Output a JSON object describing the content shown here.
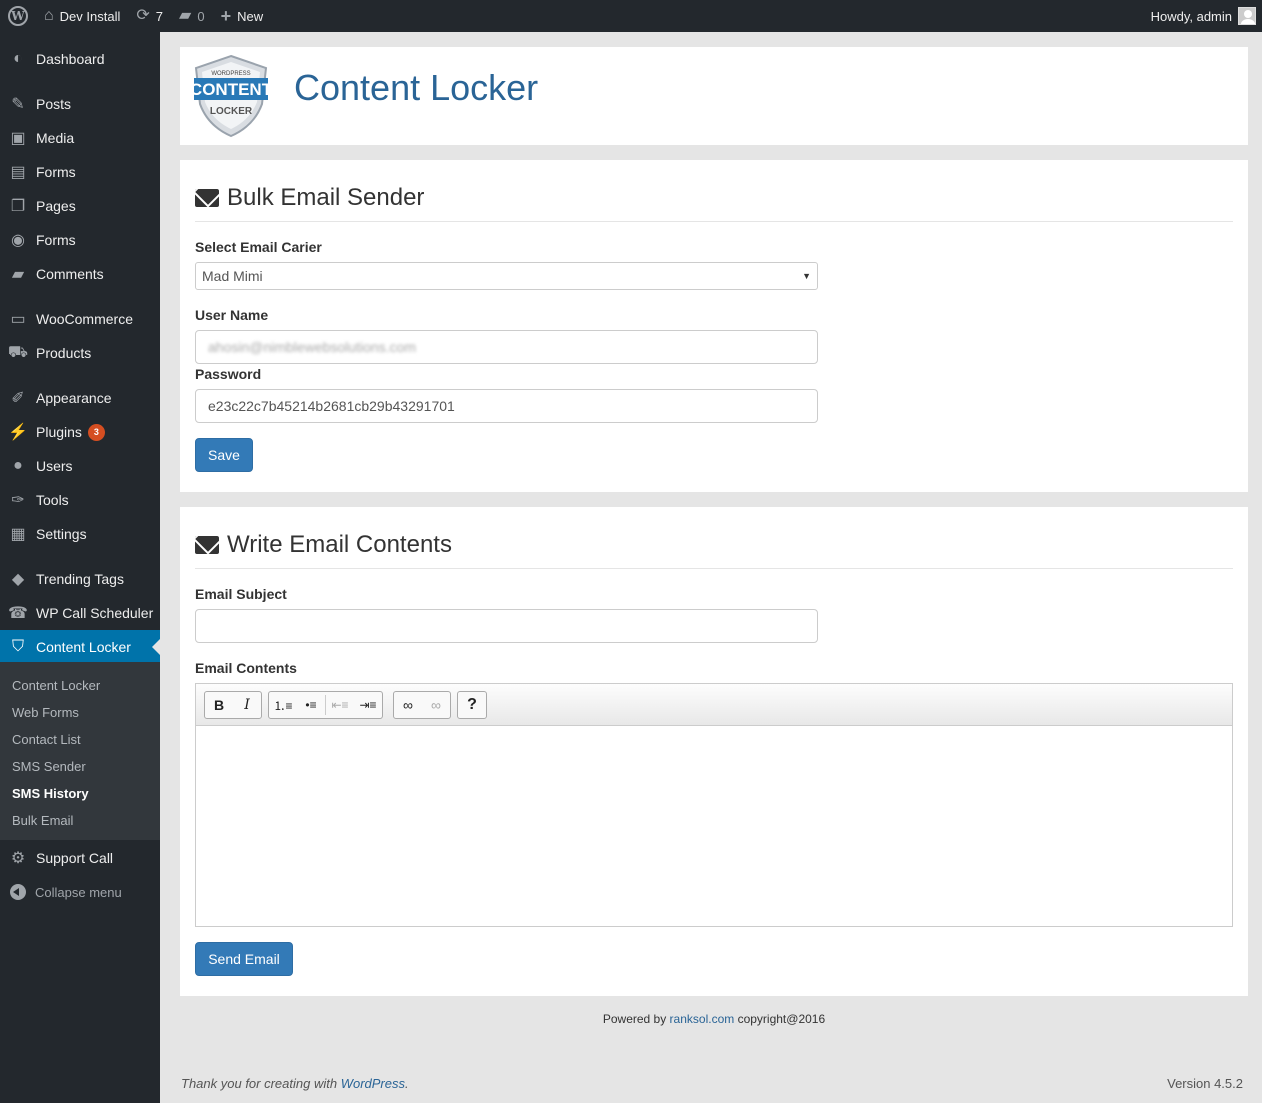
{
  "adminbar": {
    "site_name": "Dev Install",
    "updates_count": "7",
    "comments_count": "0",
    "new_label": "New",
    "howdy": "Howdy, admin"
  },
  "sidebar": {
    "items": [
      {
        "label": "Dashboard",
        "icon": "dashboard-icon"
      },
      {
        "label": "Posts",
        "icon": "pin-icon"
      },
      {
        "label": "Media",
        "icon": "media-icon"
      },
      {
        "label": "Forms",
        "icon": "forms-icon"
      },
      {
        "label": "Pages",
        "icon": "pages-icon"
      },
      {
        "label": "Forms",
        "icon": "forms-circle-icon"
      },
      {
        "label": "Comments",
        "icon": "comment-icon"
      },
      {
        "label": "WooCommerce",
        "icon": "woo-icon"
      },
      {
        "label": "Products",
        "icon": "cart-icon"
      },
      {
        "label": "Appearance",
        "icon": "brush-icon"
      },
      {
        "label": "Plugins",
        "icon": "plug-icon",
        "badge": "3"
      },
      {
        "label": "Users",
        "icon": "user-icon"
      },
      {
        "label": "Tools",
        "icon": "wrench-icon"
      },
      {
        "label": "Settings",
        "icon": "settings-icon"
      },
      {
        "label": "Trending Tags",
        "icon": "tag-icon"
      },
      {
        "label": "WP Call Scheduler",
        "icon": "phone-icon"
      },
      {
        "label": "Content Locker",
        "icon": "shield-icon"
      },
      {
        "label": "Support Call",
        "icon": "gear-icon"
      }
    ],
    "submenu": [
      "Content Locker",
      "Web Forms",
      "Contact List",
      "SMS Sender",
      "SMS History",
      "Bulk Email"
    ],
    "collapse_label": "Collapse menu"
  },
  "header": {
    "title": "Content Locker",
    "logo": {
      "top": "WORDPRESS",
      "main": "CONTENT",
      "bottom": "LOCKER"
    }
  },
  "bulk": {
    "title": "Bulk Email Sender",
    "carrier_label": "Select Email Carier",
    "carrier_value": "Mad Mimi",
    "username_label": "User Name",
    "username_value": "ahosin@nimblewebsolutions.com",
    "password_label": "Password",
    "password_value": "e23c22c7b45214b2681cb29b43291701",
    "save_label": "Save"
  },
  "write": {
    "title": "Write Email Contents",
    "subject_label": "Email Subject",
    "subject_value": "",
    "contents_label": "Email Contents",
    "send_label": "Send Email"
  },
  "footer": {
    "powered_prefix": "Powered by ",
    "powered_link": "ranksol.com",
    "powered_suffix": " copyright@2016",
    "thanks_prefix": "Thank you for creating with ",
    "thanks_link": "WordPress",
    "thanks_suffix": ".",
    "version": "Version 4.5.2"
  }
}
